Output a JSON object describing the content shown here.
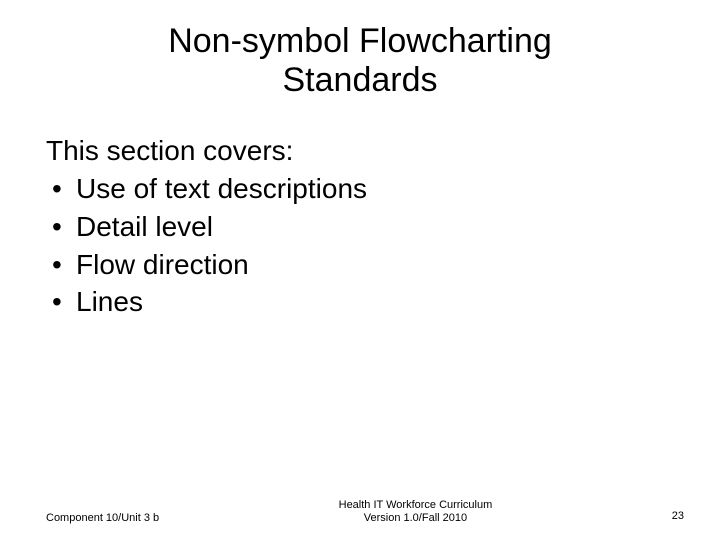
{
  "title_line1": "Non-symbol Flowcharting",
  "title_line2": "Standards",
  "intro": "This section covers:",
  "bullets": {
    "b0": "Use of text descriptions",
    "b1": "Detail level",
    "b2": "Flow direction",
    "b3": "Lines"
  },
  "footer": {
    "left": "Component 10/Unit 3 b",
    "center_line1": "Health IT Workforce Curriculum",
    "center_line2": "Version 1.0/Fall 2010",
    "right": "23"
  }
}
